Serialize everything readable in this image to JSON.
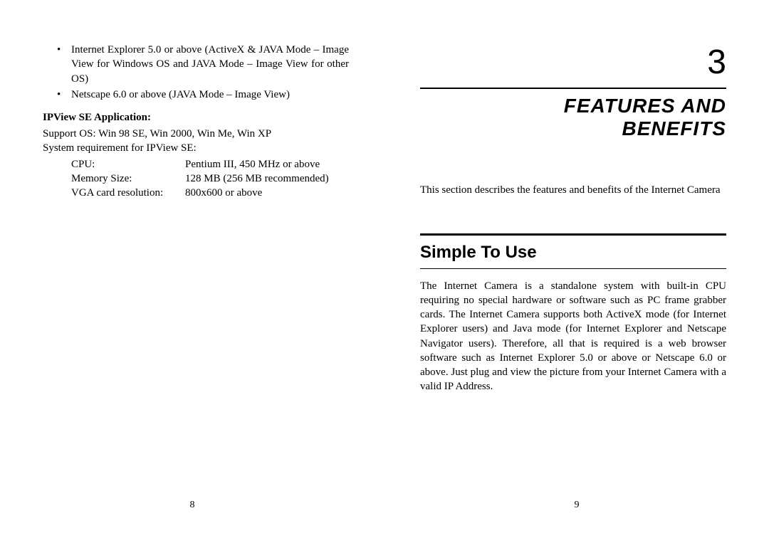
{
  "left_page": {
    "bullet_1": "Internet Explorer 5.0 or above (ActiveX & JAVA Mode – Image View for Windows OS and JAVA Mode – Image View for other OS)",
    "bullet_2": "Netscape 6.0 or above (JAVA Mode – Image View)",
    "section_heading": "IPView SE Application:",
    "support_os": "Support OS: Win 98 SE, Win 2000, Win Me, Win XP",
    "sysreq_intro": "System requirement for IPView SE:",
    "specs": {
      "cpu_label": "CPU:",
      "cpu_value": "Pentium III, 450 MHz or above",
      "memory_label": "Memory Size:",
      "memory_value": "128 MB (256 MB recommended)",
      "vga_label": "VGA card resolution:",
      "vga_value": "800x600 or above"
    },
    "page_number": "8"
  },
  "right_page": {
    "chapter_number": "3",
    "chapter_title_line1": "FEATURES AND",
    "chapter_title_line2": "BENEFITS",
    "intro": "This section describes the features and benefits of the Internet Camera",
    "section_title": "Simple To Use",
    "body": "The Internet Camera is a standalone system with built-in CPU requiring no special hardware or software such as PC frame grabber cards.  The Internet Camera supports both ActiveX mode (for Internet Explorer users) and Java mode (for Internet Explorer and Netscape Navigator users).  Therefore, all that is required is a web browser software such as Internet Explorer 5.0 or above or Netscape 6.0 or above.  Just plug and view the picture from your Internet Camera with a valid IP Address.",
    "page_number": "9"
  }
}
